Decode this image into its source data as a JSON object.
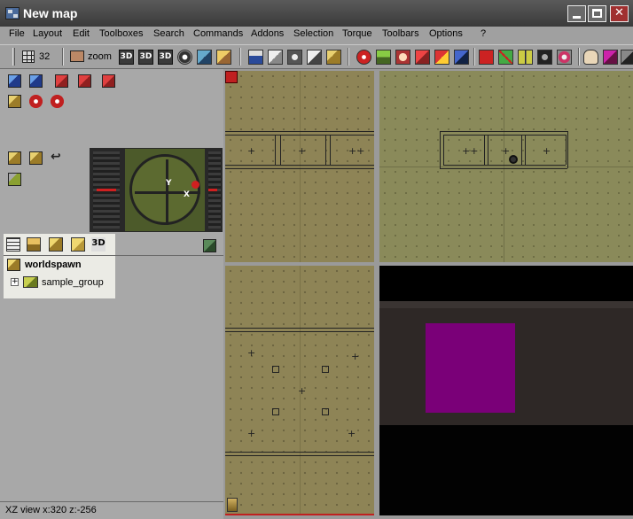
{
  "window": {
    "title": "New map"
  },
  "menu": [
    "File",
    "Layout",
    "Edit",
    "Toolboxes",
    "Search",
    "Commands",
    "Addons",
    "Selection",
    "Torque",
    "Toolbars",
    "Options",
    "?"
  ],
  "toolbar": {
    "grid_size": "32",
    "zoom_label": "zoom",
    "view_buttons": [
      "3D",
      "3D",
      "3D"
    ],
    "icons": [
      "grid-icon",
      "zoom-icon",
      "target-icon",
      "layers-icon",
      "texture-icon",
      "entity-icon",
      "brush-icon",
      "cube-icon",
      "compass-icon",
      "landscape-icon",
      "face-icon",
      "red-tool-icon",
      "bucket-icon",
      "blue-tool-icon",
      "stop-icon",
      "cross-icon",
      "bowtie-icon",
      "binoculars-icon",
      "gear-icon",
      "hand-icon",
      "die-icon"
    ]
  },
  "compass": {
    "x_label": "X",
    "y_label": "Y"
  },
  "tree": {
    "tools_label_3d": "3D",
    "root": "worldspawn",
    "children": [
      {
        "label": "sample_group",
        "expanded": false,
        "expand_glyph": "+"
      }
    ]
  },
  "viewports": {
    "colors": {
      "grid_2d": "#8e8456",
      "box_3d": "#7a0078",
      "wall_3d": "#2e2826"
    }
  },
  "status": {
    "text": "XZ view x:320 z:-256"
  }
}
